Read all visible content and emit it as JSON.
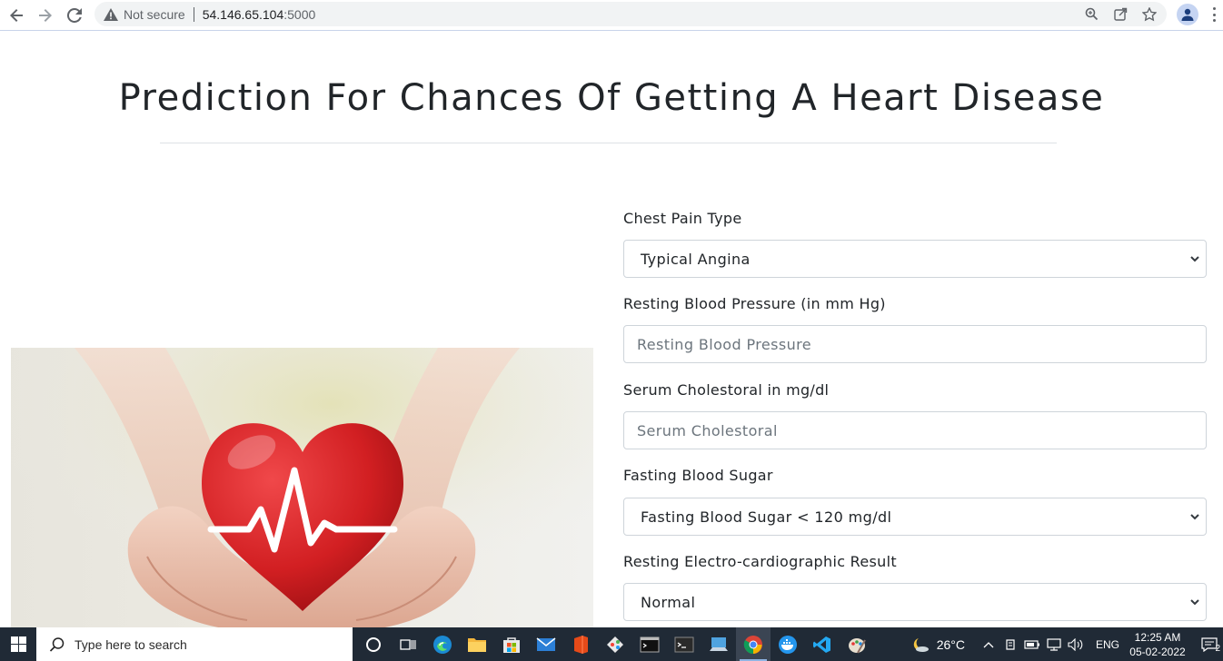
{
  "browser": {
    "security_label": "Not secure",
    "url_host": "54.146.65.104",
    "url_port": ":5000",
    "icons": [
      "back-icon",
      "forward-icon",
      "reload-icon",
      "warning-icon",
      "zoom-icon",
      "share-icon",
      "bookmark-star-icon",
      "profile-icon",
      "menu-icon"
    ]
  },
  "page": {
    "title": "Prediction For Chances Of Getting A Heart Disease",
    "image_alt": "heart in hands with heartbeat line"
  },
  "form": {
    "chest_pain": {
      "label": "Chest Pain Type",
      "value": "Typical Angina"
    },
    "resting_bp": {
      "label": "Resting Blood Pressure (in mm Hg)",
      "placeholder": "Resting Blood Pressure"
    },
    "cholesterol": {
      "label": "Serum Cholestoral in mg/dl",
      "placeholder": "Serum Cholestoral"
    },
    "fasting_sugar": {
      "label": "Fasting Blood Sugar",
      "value": "Fasting Blood Sugar < 120 mg/dl"
    },
    "ecg": {
      "label": "Resting Electro-cardiographic Result",
      "value": "Normal"
    }
  },
  "taskbar": {
    "search_placeholder": "Type here to search",
    "weather_temp": "26°C",
    "language": "ENG",
    "time": "12:25 AM",
    "date": "05-02-2022",
    "notification_count": "2"
  }
}
